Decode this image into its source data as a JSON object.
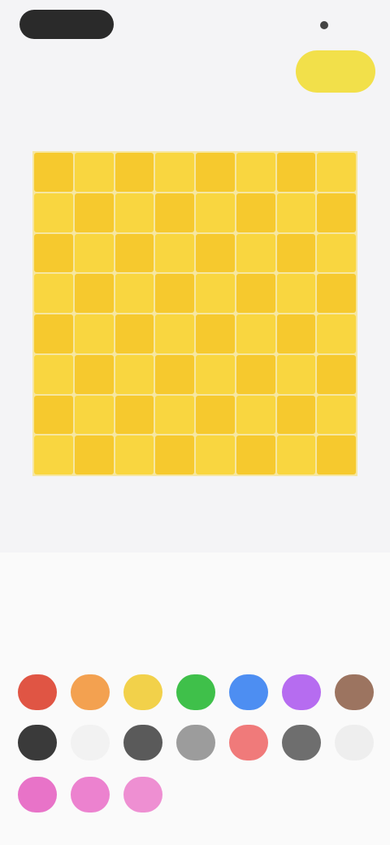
{
  "header": {
    "back_label": "",
    "top_right_label": "",
    "sub_caption": "",
    "action_label": ""
  },
  "canvas": {
    "label_left": "",
    "label_right": "",
    "footer": "",
    "rows": 8,
    "cols": 8,
    "cell_colors": [
      "#f6c92e",
      "#f9d640"
    ]
  },
  "palette": {
    "title": "",
    "tabs": [
      "",
      "",
      "",
      ""
    ],
    "swatches": [
      {
        "name": "red",
        "color": "#e05544"
      },
      {
        "name": "orange",
        "color": "#f3a150"
      },
      {
        "name": "yellow",
        "color": "#f2d14a"
      },
      {
        "name": "green",
        "color": "#3fc04a"
      },
      {
        "name": "blue",
        "color": "#4d8ef2"
      },
      {
        "name": "purple",
        "color": "#b66cf0"
      },
      {
        "name": "brown",
        "color": "#9c7460"
      },
      {
        "name": "dark-gray",
        "color": "#3a3a3a"
      },
      {
        "name": "white",
        "color": "#f2f2f2"
      },
      {
        "name": "charcoal",
        "color": "#5a5a5a"
      },
      {
        "name": "gray",
        "color": "#9c9c9c"
      },
      {
        "name": "pink-red",
        "color": "#f07a7a"
      },
      {
        "name": "slate",
        "color": "#6e6e6e"
      },
      {
        "name": "off-white",
        "color": "#eeeeee"
      },
      {
        "name": "pink",
        "color": "#e873c8"
      },
      {
        "name": "light-pink",
        "color": "#ec82cf"
      },
      {
        "name": "blush",
        "color": "#ee8fd2"
      }
    ]
  }
}
